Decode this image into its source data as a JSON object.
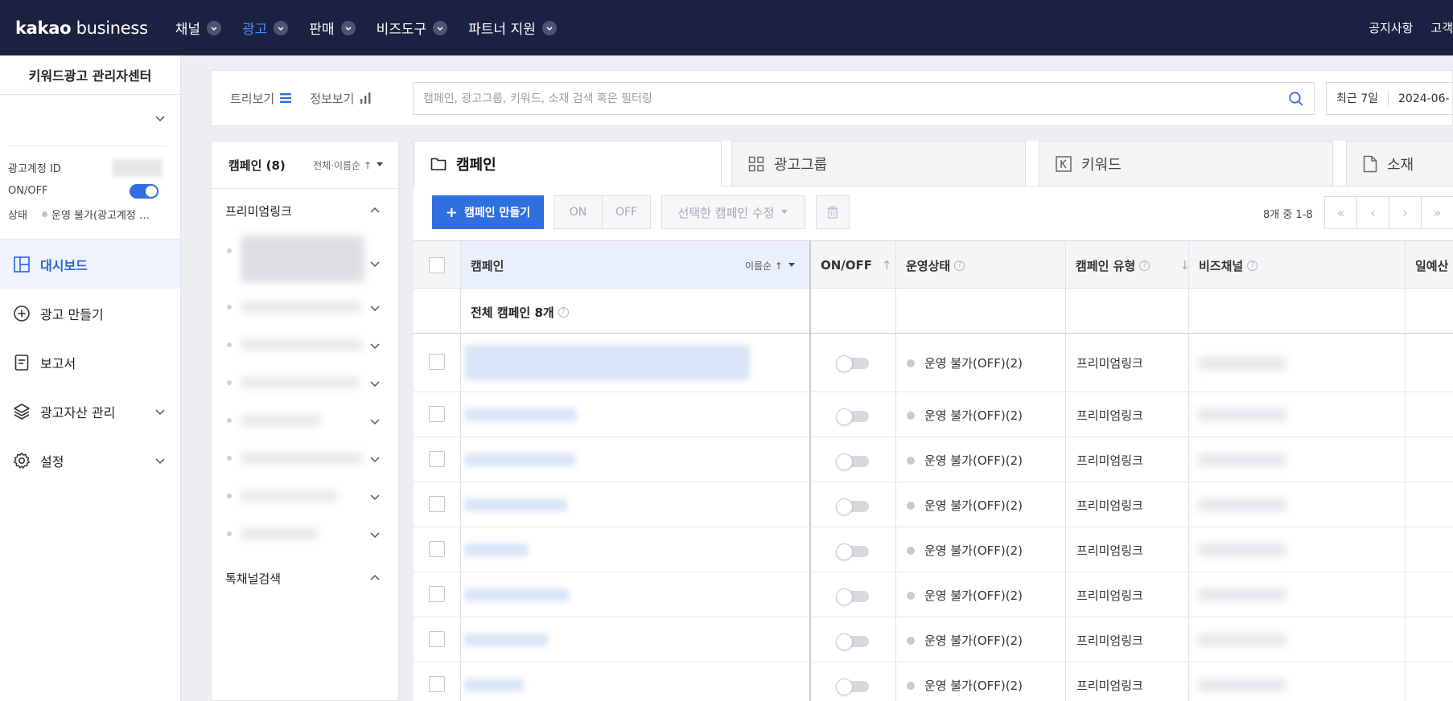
{
  "topnav": {
    "logo_bold": "kakao",
    "logo_light": " business",
    "items": [
      {
        "label": "채널",
        "active": false
      },
      {
        "label": "광고",
        "active": true
      },
      {
        "label": "판매",
        "active": false
      },
      {
        "label": "비즈도구",
        "active": false
      },
      {
        "label": "파트너 지원",
        "active": false
      }
    ],
    "right_links": [
      "공지사항",
      "고객"
    ]
  },
  "sidebar": {
    "title": "키워드광고 관리자센터",
    "account_id_label": "광고계정 ID",
    "onoff_label": "ON/OFF",
    "onoff_state": "on",
    "status_label": "상태",
    "status_value": "운영 불가(광고계정 …",
    "menu": [
      {
        "label": "대시보드",
        "icon": "dashboard-icon",
        "active": true,
        "expandable": false
      },
      {
        "label": "광고 만들기",
        "icon": "plus-circle-icon",
        "active": false,
        "expandable": false
      },
      {
        "label": "보고서",
        "icon": "report-icon",
        "active": false,
        "expandable": false
      },
      {
        "label": "광고자산 관리",
        "icon": "layers-icon",
        "active": false,
        "expandable": true
      },
      {
        "label": "설정",
        "icon": "gear-icon",
        "active": false,
        "expandable": true
      }
    ]
  },
  "filterbar": {
    "tree_view_label": "트리보기",
    "info_view_label": "정보보기",
    "search_placeholder": "캠페인, 광고그룹, 키워드, 소재 검색 혹은 필터링",
    "period_label": "최근 7일",
    "date_value": "2024-06-"
  },
  "tree": {
    "header": "캠페인 (8)",
    "sort_label": "전체·이름순 ↑",
    "group1": "프리미엄링크",
    "group2": "톡채널검색"
  },
  "tabs": [
    {
      "label": "캠페인",
      "icon": "folder-icon",
      "active": true
    },
    {
      "label": "광고그룹",
      "icon": "grid-icon",
      "active": false
    },
    {
      "label": "키워드",
      "icon": "keyword-icon",
      "active": false
    },
    {
      "label": "소재",
      "icon": "document-icon",
      "active": false
    }
  ],
  "toolbar": {
    "create_label": "캠페인 만들기",
    "on_label": "ON",
    "off_label": "OFF",
    "edit_label": "선택한 캠페인 수정",
    "pager_text": "8개 중 1-8"
  },
  "table": {
    "headers": {
      "campaign": "캠페인",
      "campaign_sort": "이름순 ↑",
      "onoff": "ON/OFF",
      "onoff_sort": "↑",
      "status": "운영상태",
      "type": "캠페인 유형",
      "type_sort": "↓",
      "bizchannel": "비즈채널",
      "budget": "일예산"
    },
    "total_label": "전체 캠페인 8개",
    "rows": [
      {
        "status": "운영 불가(OFF)(2)",
        "type": "프리미엄링크"
      },
      {
        "status": "운영 불가(OFF)(2)",
        "type": "프리미엄링크"
      },
      {
        "status": "운영 불가(OFF)(2)",
        "type": "프리미엄링크"
      },
      {
        "status": "운영 불가(OFF)(2)",
        "type": "프리미엄링크"
      },
      {
        "status": "운영 불가(OFF)(2)",
        "type": "프리미엄링크"
      },
      {
        "status": "운영 불가(OFF)(2)",
        "type": "프리미엄링크"
      },
      {
        "status": "운영 불가(OFF)(2)",
        "type": "프리미엄링크"
      },
      {
        "status": "운영 불가(OFF)(2)",
        "type": "프리미엄링크"
      }
    ]
  }
}
